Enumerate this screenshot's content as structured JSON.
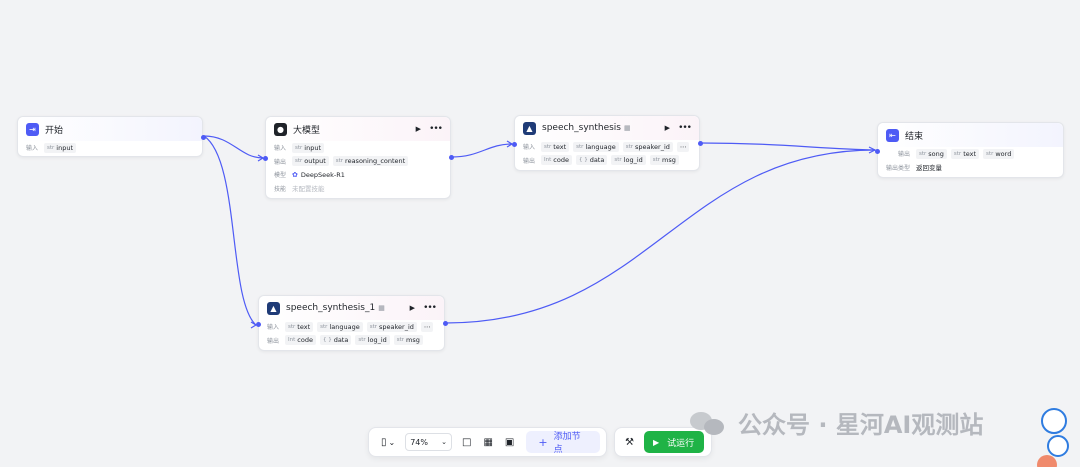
{
  "nodes": {
    "start": {
      "title": "开始",
      "input_label": "输入",
      "input_tags": [
        {
          "type": "str",
          "name": "input"
        }
      ]
    },
    "llm": {
      "title": "大模型",
      "input_label": "输入",
      "input_tags": [
        {
          "type": "str",
          "name": "input"
        }
      ],
      "output_label": "输出",
      "output_tags": [
        {
          "type": "str",
          "name": "output"
        },
        {
          "type": "str",
          "name": "reasoning_content"
        }
      ],
      "model_label": "模型",
      "model_value": "DeepSeek-R1",
      "skill_label": "技能",
      "skill_value": "未配置技能"
    },
    "speech1": {
      "title": "speech_synthesis",
      "input_label": "输入",
      "input_tags": [
        {
          "type": "str",
          "name": "text"
        },
        {
          "type": "str",
          "name": "language"
        },
        {
          "type": "str",
          "name": "speaker_id"
        }
      ],
      "output_label": "输出",
      "output_tags": [
        {
          "type": "Int",
          "name": "code"
        },
        {
          "type": "{ }",
          "name": "data"
        },
        {
          "type": "str",
          "name": "log_id"
        },
        {
          "type": "str",
          "name": "msg"
        }
      ]
    },
    "speech2": {
      "title": "speech_synthesis_1",
      "input_label": "输入",
      "input_tags": [
        {
          "type": "str",
          "name": "text"
        },
        {
          "type": "str",
          "name": "language"
        },
        {
          "type": "str",
          "name": "speaker_id"
        }
      ],
      "output_label": "输出",
      "output_tags": [
        {
          "type": "Int",
          "name": "code"
        },
        {
          "type": "{ }",
          "name": "data"
        },
        {
          "type": "str",
          "name": "log_id"
        },
        {
          "type": "str",
          "name": "msg"
        }
      ]
    },
    "end": {
      "title": "结束",
      "output_label": "输出",
      "output_tags": [
        {
          "type": "str",
          "name": "song"
        },
        {
          "type": "str",
          "name": "text"
        },
        {
          "type": "str",
          "name": "word"
        }
      ],
      "output_type_label": "输出类型",
      "output_type_value": "返回变量"
    }
  },
  "toolbar": {
    "zoom": "74%",
    "add_node_label": "添加节点",
    "run_label": "试运行"
  },
  "watermark": {
    "text": "公众号 · 星河AI观测站"
  },
  "colors": {
    "accent": "#4e5bf5",
    "run_green": "#1fb346",
    "edge": "#4e5bf5"
  }
}
